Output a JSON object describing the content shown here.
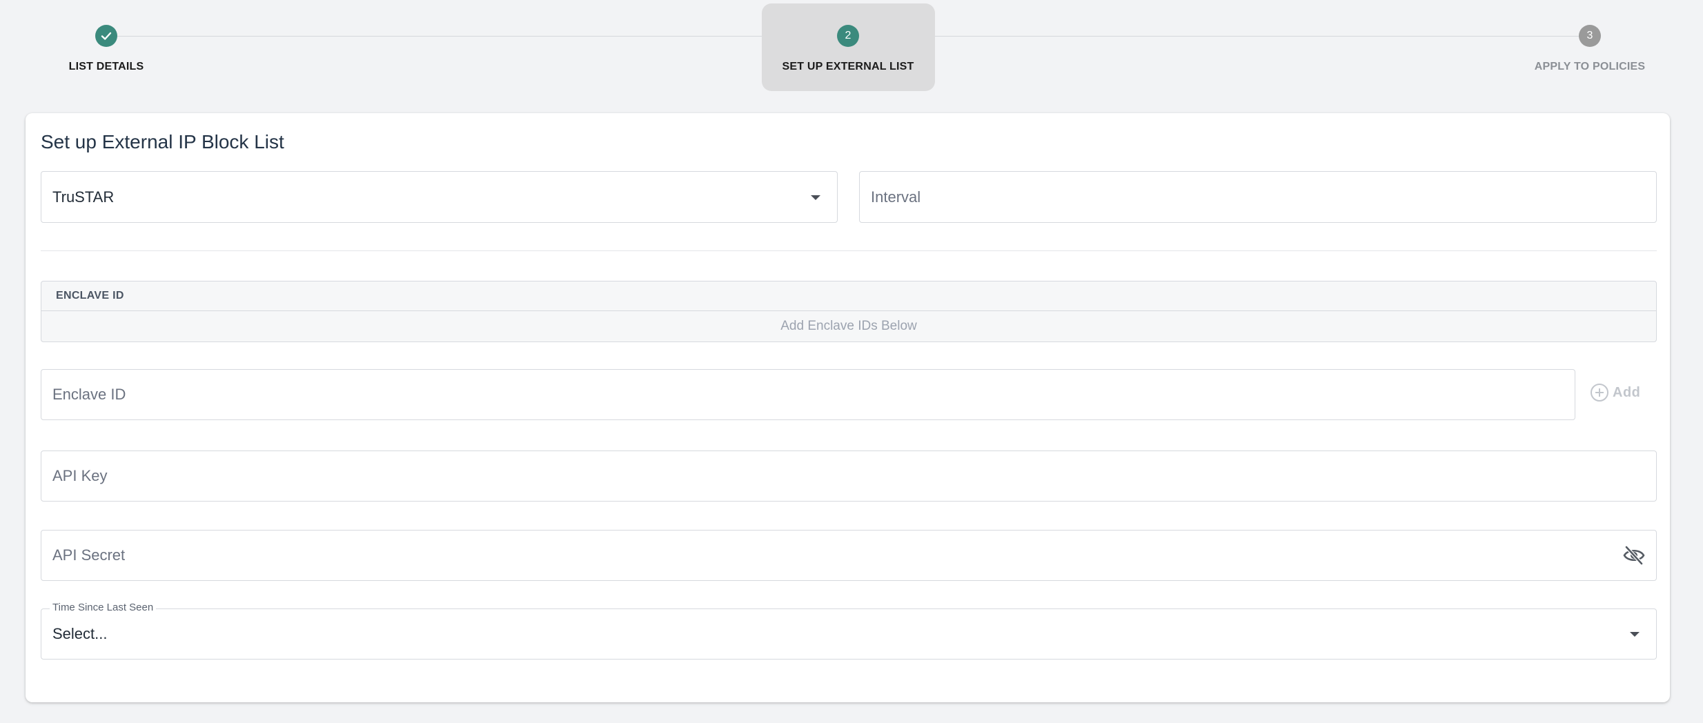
{
  "stepper": {
    "steps": [
      {
        "number": "1",
        "label": "LIST DETAILS",
        "state": "complete",
        "icon": "checkmark-icon"
      },
      {
        "number": "2",
        "label": "SET UP EXTERNAL LIST",
        "state": "active"
      },
      {
        "number": "3",
        "label": "APPLY TO POLICIES",
        "state": "pending"
      }
    ],
    "colors": {
      "active": "#3b8a7d",
      "pending": "#9a9a9a"
    }
  },
  "form": {
    "title": "Set up External IP Block List",
    "provider": {
      "value": "TruSTAR",
      "icon": "caret-down-icon"
    },
    "interval": {
      "placeholder": "Interval",
      "value": ""
    },
    "enclave_table": {
      "header": "ENCLAVE ID",
      "empty_text": "Add Enclave IDs Below"
    },
    "enclave_input": {
      "placeholder": "Enclave ID",
      "value": ""
    },
    "add_button": {
      "label": "Add",
      "icon": "plus-circle-icon"
    },
    "api_key": {
      "placeholder": "API Key",
      "value": ""
    },
    "api_secret": {
      "placeholder": "API Secret",
      "value": "",
      "icon": "eye-off-icon"
    },
    "time_since_last_seen": {
      "label": "Time Since Last Seen",
      "value": "Select...",
      "icon": "caret-down-icon"
    }
  }
}
